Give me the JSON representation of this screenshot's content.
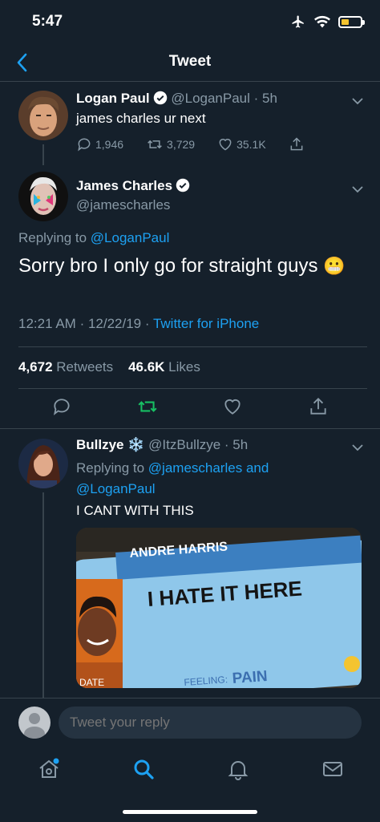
{
  "status_bar": {
    "time": "5:47"
  },
  "header": {
    "title": "Tweet"
  },
  "tweet_parent": {
    "name": "Logan Paul",
    "handle": "@LoganPaul",
    "age": "5h",
    "text": "james charles ur next",
    "replies": "1,946",
    "retweets": "3,729",
    "likes": "35.1K"
  },
  "tweet_main": {
    "name": "James Charles",
    "handle": "@jamescharles",
    "replying_label": "Replying to",
    "replying_to": "@LoganPaul",
    "text": "Sorry bro I only go for straight guys",
    "emoji": "😬",
    "time": "12:21 AM",
    "date": "12/22/19",
    "source": "Twitter for iPhone",
    "retweets_count": "4,672",
    "retweets_label": "Retweets",
    "likes_count": "46.6K",
    "likes_label": "Likes"
  },
  "tweet_reply": {
    "name": "Bullzye",
    "name_emoji": "❄️",
    "handle": "@ItzBullzye",
    "age": "5h",
    "replying_label": "Replying to",
    "replying_to_1": "@jamescharles",
    "replying_and": "and",
    "replying_to_2": "@LoganPaul",
    "text": "I CANT WITH THIS",
    "image_text": {
      "name_banner": "ANDRE HARRIS",
      "headline": "I HATE IT HERE",
      "field_date": "DATE",
      "field_feeling": "FEELING:",
      "feeling_value": "PAIN"
    }
  },
  "composer": {
    "placeholder": "Tweet your reply"
  },
  "tabbar": {
    "tabs": [
      "home-icon",
      "search-icon",
      "notifications-icon",
      "messages-icon"
    ]
  },
  "colors": {
    "background": "#15202b",
    "accent": "#1da1f2",
    "muted": "#8899a6",
    "divider": "#38444d",
    "retweet_green": "#17bf63"
  }
}
